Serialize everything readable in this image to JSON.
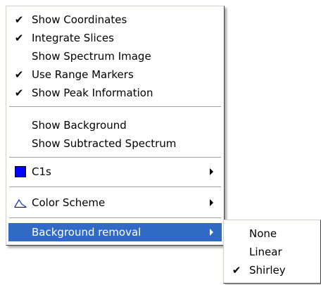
{
  "menu": {
    "items": [
      {
        "label": "Show Coordinates",
        "checked": true
      },
      {
        "label": "Integrate Slices",
        "checked": true
      },
      {
        "label": "Show Spectrum Image",
        "checked": false
      },
      {
        "label": "Use Range Markers",
        "checked": true
      },
      {
        "label": "Show Peak Information",
        "checked": true
      },
      {
        "label": "Show Background",
        "checked": false
      },
      {
        "label": "Show Subtracted Spectrum",
        "checked": false
      },
      {
        "label": "C1s",
        "swatch_color": "#0000ff",
        "has_submenu": true
      },
      {
        "label": "Color Scheme",
        "icon": "spectrum-peak-icon",
        "has_submenu": true
      },
      {
        "label": "Background removal",
        "has_submenu": true,
        "highlighted": true
      }
    ],
    "highlight_color": "#316ac5",
    "check_glyph": "✔"
  },
  "submenu": {
    "items": [
      {
        "label": "None",
        "checked": false
      },
      {
        "label": "Linear",
        "checked": false
      },
      {
        "label": "Shirley",
        "checked": true
      }
    ]
  }
}
